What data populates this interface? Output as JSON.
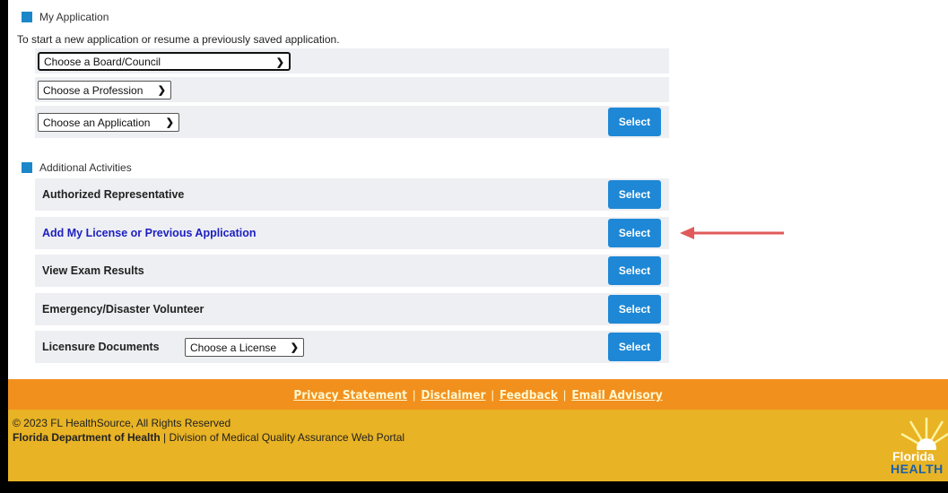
{
  "my_application": {
    "title": "My Application",
    "intro": "To start a new application or resume a previously saved application.",
    "board_select": "Choose a Board/Council",
    "profession_select": "Choose a Profession",
    "application_select": "Choose an Application",
    "select_label": "Select"
  },
  "additional_activities": {
    "title": "Additional Activities",
    "rows": [
      {
        "label": "Authorized Representative",
        "button": "Select"
      },
      {
        "label": "Add My License or Previous Application",
        "button": "Select"
      },
      {
        "label": "View Exam Results",
        "button": "Select"
      },
      {
        "label": "Emergency/Disaster Volunteer",
        "button": "Select"
      },
      {
        "label": "Licensure Documents",
        "button": "Select",
        "dropdown": "Choose a License"
      }
    ]
  },
  "footer": {
    "links": [
      "Privacy Statement",
      "Disclaimer",
      "Feedback",
      "Email Advisory"
    ],
    "separator": "|",
    "copyright": "© 2023 FL HealthSource, All Rights Reserved",
    "dept_bold": "Florida Department of Health",
    "dept_rest": " | Division of Medical Quality Assurance Web Portal",
    "logo_line1": "Florida",
    "logo_line2": "HEALTH"
  },
  "colors": {
    "accent_blue": "#1e88d6",
    "footer_orange": "#f2901d",
    "footer_gold": "#e8b324",
    "annotation_arrow": "#e05a5a"
  }
}
